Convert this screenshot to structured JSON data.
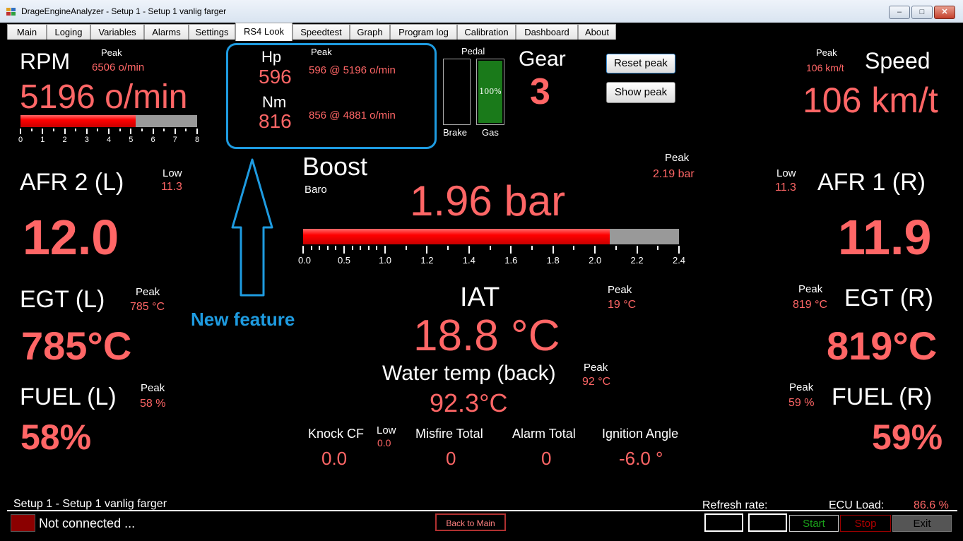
{
  "window": {
    "title": "DrageEngineAnalyzer - Setup 1 - Setup 1 vanlig farger",
    "controls": [
      "–",
      "□",
      "✕"
    ]
  },
  "tabs": [
    "Main",
    "Loging",
    "Variables",
    "Alarms",
    "Settings",
    "RS4 Look",
    "Speedtest",
    "Graph",
    "Program log",
    "Calibration",
    "Dashboard",
    "About"
  ],
  "active_tab": "RS4 Look",
  "rpm": {
    "label": "RPM",
    "peak_label": "Peak",
    "peak": "6506 o/min",
    "value": "5196 o/min",
    "bar_fraction": 0.65,
    "ticks": [
      "0",
      "1",
      "2",
      "3",
      "4",
      "5",
      "6",
      "7",
      "8"
    ]
  },
  "power": {
    "hp_label": "Hp",
    "hp": "596",
    "peak_label": "Peak",
    "hp_peak": "596 @ 5196 o/min",
    "nm_label": "Nm",
    "nm": "816",
    "nm_peak": "856 @ 4881 o/min"
  },
  "pedal": {
    "label": "Pedal",
    "brake_label": "Brake",
    "gas_label": "Gas",
    "gas_value": "100%",
    "gas_fraction": 1.0,
    "brake_fraction": 0.0
  },
  "gear": {
    "label": "Gear",
    "value": "3"
  },
  "buttons": {
    "reset_peak": "Reset peak",
    "show_peak": "Show peak",
    "back_to_main": "Back to Main",
    "start": "Start",
    "stop": "Stop",
    "exit": "Exit"
  },
  "speed": {
    "label": "Speed",
    "peak_label": "Peak",
    "peak": "106 km/t",
    "value": "106 km/t"
  },
  "annotation": {
    "text": "New feature",
    "color": "#1e9be0"
  },
  "afr_left": {
    "label": "AFR  2 (L)",
    "low_label": "Low",
    "low": "11.3",
    "value": "12.0"
  },
  "afr_right": {
    "label": "AFR  1 (R)",
    "low_label": "Low",
    "low": "11.3",
    "value": "11.9"
  },
  "boost": {
    "label": "Boost",
    "sub_label": "Baro",
    "value": "1.96 bar",
    "peak_label": "Peak",
    "peak": "2.19 bar",
    "bar_fraction": 0.8167,
    "ticks": [
      "0.0",
      "0.5",
      "1.0",
      "1.2",
      "1.4",
      "1.6",
      "1.8",
      "2.0",
      "2.2",
      "2.4"
    ]
  },
  "egt_left": {
    "label": "EGT (L)",
    "peak_label": "Peak",
    "peak": "785 °C",
    "value": "785°C"
  },
  "egt_right": {
    "label": "EGT (R)",
    "peak_label": "Peak",
    "peak": "819 °C",
    "value": "819°C"
  },
  "iat": {
    "label": "IAT",
    "peak_label": "Peak",
    "peak": "19 °C",
    "value": "18.8 °C"
  },
  "water": {
    "label": "Water temp (back)",
    "peak_label": "Peak",
    "peak": "92 °C",
    "value": "92.3°C"
  },
  "fuel_left": {
    "label": "FUEL (L)",
    "peak_label": "Peak",
    "peak": "58 %",
    "value": "58%"
  },
  "fuel_right": {
    "label": "FUEL (R)",
    "peak_label": "Peak",
    "peak": "59 %",
    "value": "59%"
  },
  "knock": {
    "label": "Knock CF",
    "low_label": "Low",
    "low": "0.0",
    "value": "0.0"
  },
  "misfire": {
    "label": "Misfire Total",
    "value": "0"
  },
  "alarm": {
    "label": "Alarm Total",
    "value": "0"
  },
  "ignition": {
    "label": "Ignition Angle",
    "value": "-6.0 °"
  },
  "footer": {
    "setup_text": "Setup 1 - Setup 1 vanlig farger",
    "refresh_label": "Refresh rate:",
    "ecu_label": "ECU Load:",
    "ecu_value": "86.6 %",
    "connection": "Not connected ..."
  },
  "colors": {
    "value_red": "#ff6666",
    "bar_red": "#ff0000",
    "gas_green": "#1a7a1a",
    "status_indicator": "#8b0000",
    "start_green": "#1aa01a",
    "stop_red": "#b00000"
  }
}
